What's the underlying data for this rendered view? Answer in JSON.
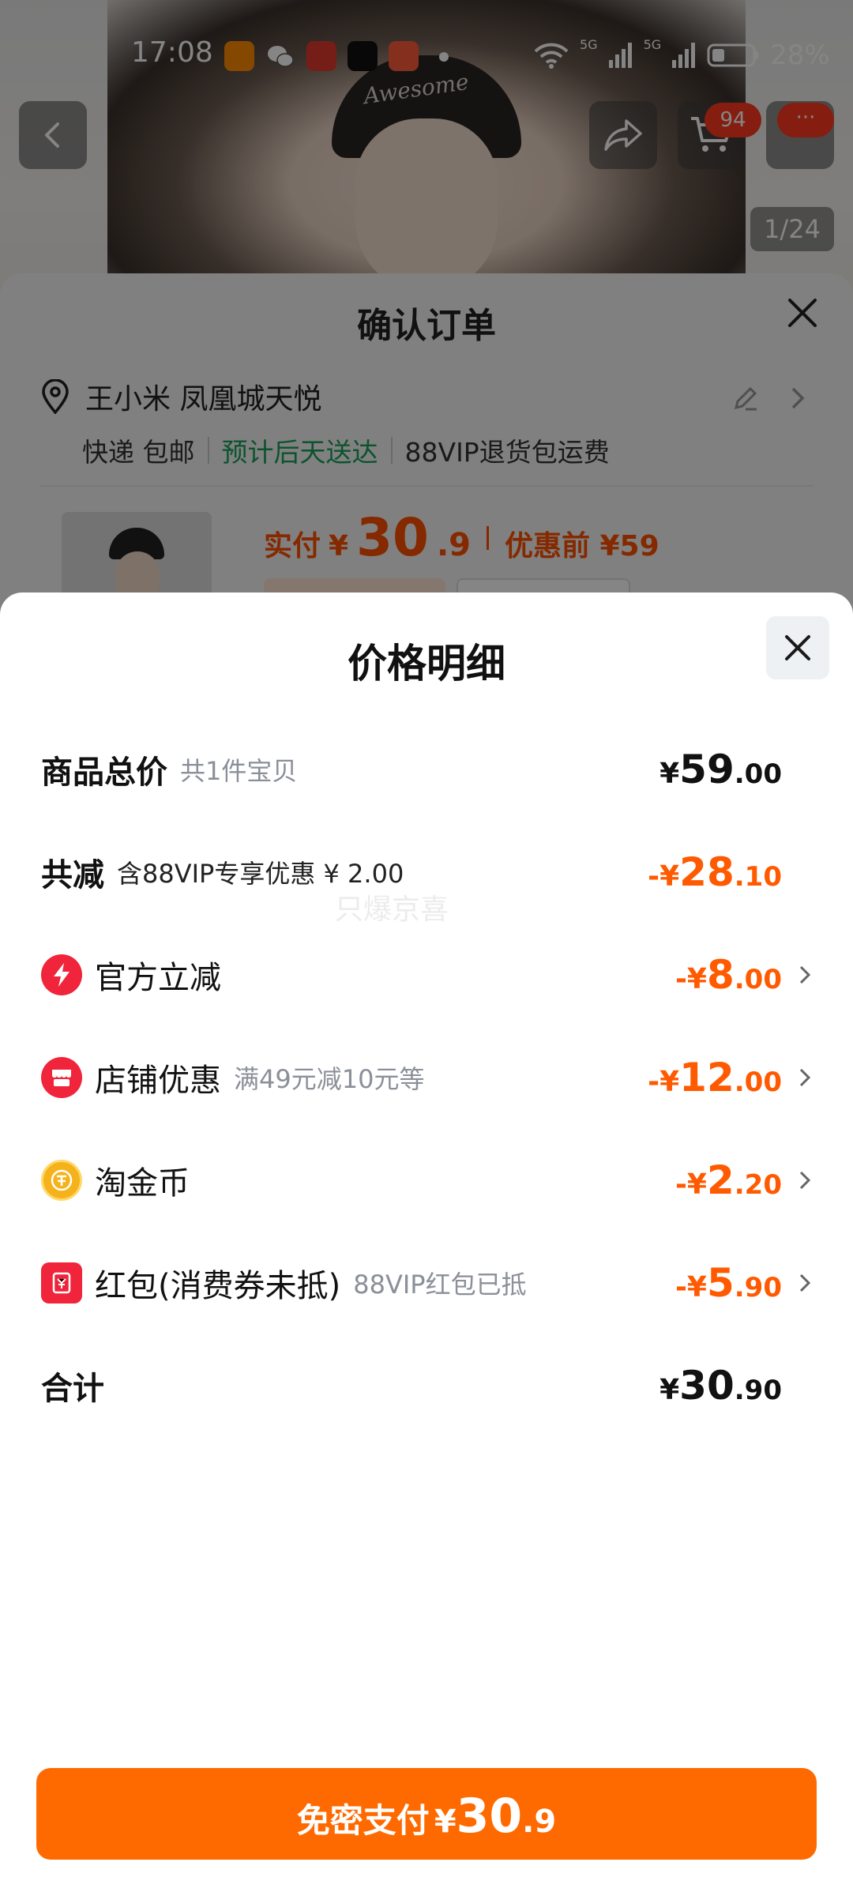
{
  "status_bar": {
    "time": "17:08",
    "network_1": "5G",
    "network_2": "5G",
    "battery": "28%"
  },
  "product_page": {
    "cart_badge": "94",
    "more_badge": "···",
    "image_counter": "1/24",
    "cap_text": "Awesome"
  },
  "order_confirm": {
    "title": "确认订单",
    "address": "王小米 凤凰城天悦",
    "shipping": "快递 包邮",
    "delivery": "预计后天送达",
    "return_shipping": "88VIP退货包运费",
    "paid_label": "实付",
    "paid_yen": "¥",
    "paid_int": "30",
    "paid_dec": ".9",
    "before_label": "优惠前 ¥59"
  },
  "price_detail": {
    "title": "价格明细",
    "watermark": "只爆京喜",
    "total": {
      "label": "商品总价",
      "sub": "共1件宝贝",
      "yen": "¥",
      "int": "59",
      "dec": ".00"
    },
    "reduction": {
      "label": "共减",
      "sub": "含88VIP专享优惠 ¥ 2.00",
      "yen": "-¥",
      "int": "28",
      "dec": ".10"
    },
    "items": [
      {
        "label": "官方立减",
        "sub": "",
        "yen": "-¥",
        "int": "8",
        "dec": ".00",
        "icon": "lightning-icon"
      },
      {
        "label": "店铺优惠",
        "sub": "满49元减10元等",
        "yen": "-¥",
        "int": "12",
        "dec": ".00",
        "icon": "shop-icon"
      },
      {
        "label": "淘金币",
        "sub": "",
        "yen": "-¥",
        "int": "2",
        "dec": ".20",
        "icon": "coin-icon"
      },
      {
        "label": "红包(消费券未抵)",
        "sub": "88VIP红包已抵",
        "yen": "-¥",
        "int": "5",
        "dec": ".90",
        "icon": "red-packet-icon"
      }
    ],
    "sum": {
      "label": "合计",
      "yen": "¥",
      "int": "30",
      "dec": ".90"
    }
  },
  "pay_button": {
    "label": "免密支付",
    "yen": "¥",
    "int": "30",
    "dec": ".9"
  },
  "colors": {
    "accent_orange": "#ff6a00",
    "discount_orange": "#ff5a00",
    "delivery_green": "#18a058",
    "official_red": "#f0243a",
    "coin_gold": "#f6b21a"
  }
}
